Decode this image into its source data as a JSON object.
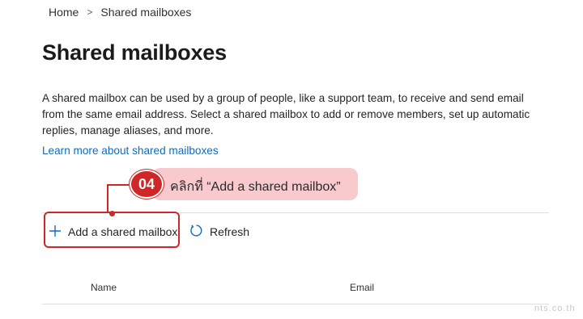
{
  "breadcrumb": {
    "home": "Home",
    "separator": ">",
    "current": "Shared mailboxes"
  },
  "page": {
    "title": "Shared mailboxes",
    "description": "A shared mailbox can be used by a group of people, like a support team, to receive and send email from the same email address. Select a shared mailbox to add or remove members, set up automatic replies, manage aliases, and more.",
    "learn_more": "Learn more about shared mailboxes"
  },
  "toolbar": {
    "add_label": "Add a shared mailbox",
    "refresh_label": "Refresh"
  },
  "table": {
    "columns": [
      "Name",
      "Email"
    ]
  },
  "annotation": {
    "step": "04",
    "text": "คลิกที่ “Add a shared mailbox”",
    "accent": "#d12628",
    "pill_color": "#f8c9cd"
  },
  "watermark": "nts.co.th",
  "icons": {
    "add": "plus-icon",
    "refresh": "refresh-icon"
  },
  "colors": {
    "link": "#0f6cbd",
    "accent": "#d12628"
  }
}
